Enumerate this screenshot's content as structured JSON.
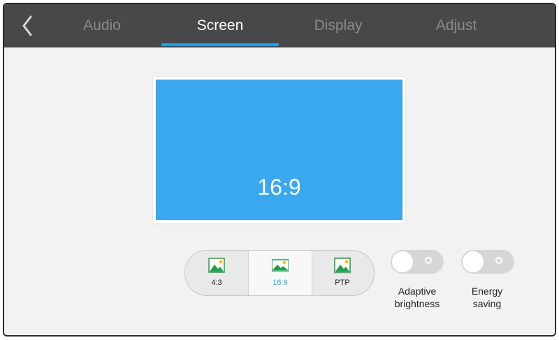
{
  "nav": {
    "back_icon": "chevron-left-icon",
    "tabs": [
      {
        "label": "Audio",
        "active": false
      },
      {
        "label": "Screen",
        "active": true
      },
      {
        "label": "Display",
        "active": false
      },
      {
        "label": "Adjust",
        "active": false
      }
    ],
    "accent": "#1ea0e6"
  },
  "preview": {
    "ratio_label": "16:9",
    "color": "#3aa8ee"
  },
  "aspect_ratio": {
    "options": [
      {
        "label": "4:3",
        "icon": "image-icon",
        "selected": false
      },
      {
        "label": "16:9",
        "icon": "image-icon",
        "selected": true
      },
      {
        "label": "PTP",
        "icon": "image-icon",
        "selected": false
      }
    ]
  },
  "toggles": {
    "adaptive_brightness": {
      "line1": "Adaptive",
      "line2": "brightness",
      "on": false
    },
    "energy_saving": {
      "line1": "Energy",
      "line2": "saving",
      "on": false
    }
  }
}
